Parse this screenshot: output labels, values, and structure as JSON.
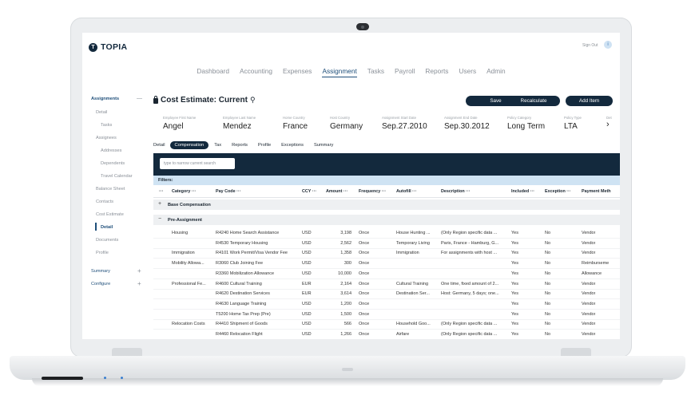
{
  "app": {
    "logo_text": "TOPIA",
    "logo_mark": "T",
    "sign_out": "Sign Out",
    "info": "i"
  },
  "topnav": [
    "Dashboard",
    "Accounting",
    "Expenses",
    "Assignment",
    "Tasks",
    "Payroll",
    "Reports",
    "Users",
    "Admin"
  ],
  "topnav_active": "Assignment",
  "sidebar": {
    "assignments": "Assignments",
    "assignments_toggle": "—",
    "detail": "Detail",
    "tasks": "Tasks",
    "assignees": "Assignees",
    "addresses": "Addresses",
    "dependents": "Dependents",
    "travel_calendar": "Travel Calendar",
    "balance_sheet": "Balance Sheet",
    "contacts": "Contacts",
    "cost_estimate": "Cost Estimate",
    "ce_detail": "Detail",
    "documents": "Documents",
    "profile": "Profile",
    "summary": "Summary",
    "summary_toggle": "+",
    "configure": "Configure",
    "configure_toggle": "+"
  },
  "page": {
    "title": "Cost Estimate: Current",
    "pin_icon": "⚲",
    "save": "Save",
    "recalculate": "Recalculate",
    "add_item": "Add Item"
  },
  "employee": {
    "first_name_label": "Employee First Name",
    "first_name": "Angel",
    "last_name_label": "Employee Last Name",
    "last_name": "Mendez",
    "home_country_label": "Home Country",
    "home_country": "France",
    "host_country_label": "Host Country",
    "host_country": "Germany",
    "start_label": "Assignment Start Date",
    "start": "Sep.27.2010",
    "end_label": "Assignment End Date",
    "end": "Sep.30.2012",
    "policy_cat_label": "Policy Category",
    "policy_cat": "Long Term",
    "policy_type_label": "Policy Type",
    "policy_type": "LTA",
    "next_label": "Det"
  },
  "subtabs": [
    "Detail",
    "Compensation",
    "Tax",
    "Reports",
    "Profile",
    "Exceptions",
    "Summary"
  ],
  "subtab_active": "Compensation",
  "search": {
    "placeholder": "type to narrow current search"
  },
  "filters_label": "Filters:",
  "columns": {
    "category": "Category",
    "paycode": "Pay Code",
    "ccy": "CCY",
    "amount": "Amount",
    "frequency": "Frequency",
    "autofill": "Autofill",
    "description": "Description",
    "included": "Included",
    "exception": "Exception",
    "payment": "Payment Meth"
  },
  "groups": {
    "base": "Base Compensation",
    "base_toggle": "+",
    "pre": "Pre-Assignment",
    "pre_toggle": "−"
  },
  "rows": [
    {
      "category": "Housing",
      "paycode": "R4240 Home Search Assistance",
      "ccy": "USD",
      "amount": "3,198",
      "frequency": "Once",
      "autofill": "House Hunting ...",
      "description": "(Only Region specific data ...",
      "included": "Yes",
      "exception": "No",
      "payment": "Vendor"
    },
    {
      "category": "",
      "paycode": "R4530 Temporary Housing",
      "ccy": "USD",
      "amount": "2,562",
      "frequency": "Once",
      "autofill": "Temporary Living",
      "description": "Paris, France - Hamburg, G...",
      "included": "Yes",
      "exception": "No",
      "payment": "Vendor"
    },
    {
      "category": "Immigration",
      "paycode": "R4101 Work Permit/Visa Vendor Fee",
      "ccy": "USD",
      "amount": "1,358",
      "frequency": "Once",
      "autofill": "Immigration",
      "description": "For assignments with host ...",
      "included": "Yes",
      "exception": "No",
      "payment": "Vendor"
    },
    {
      "category": "Mobility Allowa...",
      "paycode": "R3060 Club Joining Fee",
      "ccy": "USD",
      "amount": "300",
      "frequency": "Once",
      "autofill": "",
      "description": "",
      "included": "Yes",
      "exception": "No",
      "payment": "Reimburseme"
    },
    {
      "category": "",
      "paycode": "R3360 Mobilization Allowance",
      "ccy": "USD",
      "amount": "10,000",
      "frequency": "Once",
      "autofill": "",
      "description": "",
      "included": "Yes",
      "exception": "No",
      "payment": "Allowance"
    },
    {
      "category": "Professional Fe...",
      "paycode": "R4600 Cultural Training",
      "ccy": "EUR",
      "amount": "2,164",
      "frequency": "Once",
      "autofill": "Cultural Training",
      "description": "One time, fixed amount of 2...",
      "included": "Yes",
      "exception": "No",
      "payment": "Vendor"
    },
    {
      "category": "",
      "paycode": "R4620 Destination Services",
      "ccy": "EUR",
      "amount": "3,614",
      "frequency": "Once",
      "autofill": "Destination Ser...",
      "description": "Host: Germany, 5 days; one...",
      "included": "Yes",
      "exception": "No",
      "payment": "Vendor"
    },
    {
      "category": "",
      "paycode": "R4630 Language Training",
      "ccy": "USD",
      "amount": "1,200",
      "frequency": "Once",
      "autofill": "",
      "description": "",
      "included": "Yes",
      "exception": "No",
      "payment": "Vendor"
    },
    {
      "category": "",
      "paycode": "T5200 Home Tax Prep (Pre)",
      "ccy": "USD",
      "amount": "1,500",
      "frequency": "Once",
      "autofill": "",
      "description": "",
      "included": "Yes",
      "exception": "No",
      "payment": "Vendor"
    },
    {
      "category": "Relocation Costs",
      "paycode": "R4410 Shipment of Goods",
      "ccy": "USD",
      "amount": "566",
      "frequency": "Once",
      "autofill": "Household Goo...",
      "description": "(Only Region specific data ...",
      "included": "Yes",
      "exception": "No",
      "payment": "Vendor"
    },
    {
      "category": "",
      "paycode": "R4460 Relocation Flight",
      "ccy": "USD",
      "amount": "1,266",
      "frequency": "Once",
      "autofill": "Airfare",
      "description": "(Only Region specific data ...",
      "included": "Yes",
      "exception": "No",
      "payment": "Vendor"
    }
  ]
}
